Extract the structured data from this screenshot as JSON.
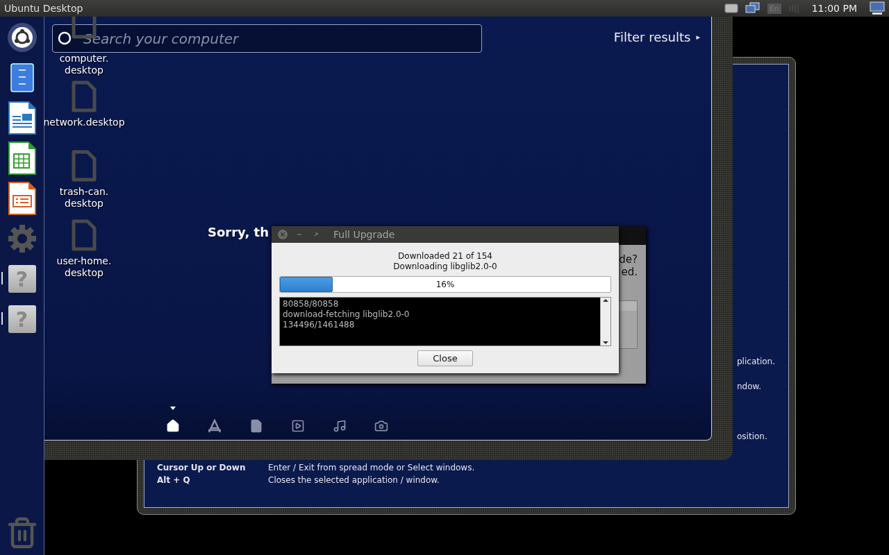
{
  "panel": {
    "title": "Ubuntu Desktop",
    "keyboard_layout": "En",
    "clock": "11:00 PM"
  },
  "launcher": {
    "items": [
      {
        "kind": "logo",
        "running": false
      },
      {
        "kind": "files",
        "running": false
      },
      {
        "kind": "writer",
        "running": false
      },
      {
        "kind": "calc",
        "running": false
      },
      {
        "kind": "impress",
        "running": false
      },
      {
        "kind": "settings",
        "running": false
      },
      {
        "kind": "help",
        "glyph": "?",
        "running": true
      },
      {
        "kind": "help",
        "glyph": "?",
        "running": true
      }
    ],
    "trash": {
      "kind": "trash"
    }
  },
  "shortcuts_window": {
    "cut_texts": [
      "plication.",
      "ndow.",
      "osition."
    ],
    "rows": [
      {
        "key": "Cursor Up or Down",
        "action": "Enter / Exit from spread mode or Select windows."
      },
      {
        "key": "Alt + Q",
        "action": "Closes the selected application / window."
      }
    ]
  },
  "dash": {
    "search": {
      "placeholder": "Search your computer"
    },
    "filter": {
      "label": "Filter results",
      "arrow": "▸"
    },
    "message": "Sorry, th",
    "lenses": [
      {
        "kind": "home",
        "selected": true
      },
      {
        "kind": "apps",
        "selected": false
      },
      {
        "kind": "files",
        "selected": false
      },
      {
        "kind": "video",
        "selected": false
      },
      {
        "kind": "music",
        "selected": false
      },
      {
        "kind": "photo",
        "selected": false
      }
    ]
  },
  "desktop_icons": [
    {
      "lines": [
        "computer.",
        "desktop"
      ]
    },
    {
      "lines": [
        "network.desktop"
      ]
    },
    {
      "lines": [
        "trash-can.",
        "desktop"
      ]
    },
    {
      "lines": [
        "user-home.",
        "desktop"
      ]
    }
  ],
  "back_dialog": {
    "texts": [
      "de?",
      "ed."
    ]
  },
  "upgrade_dialog": {
    "title": "Full Upgrade",
    "status": "Downloaded 21 of 154",
    "detail": "Downloading libglib2.0-0",
    "progress": {
      "level": 0.16,
      "reading": "16%"
    },
    "log": [
      "80858/80858",
      "download-fetching libglib2.0-0",
      "134496/1461488"
    ],
    "close_button": "Close"
  }
}
